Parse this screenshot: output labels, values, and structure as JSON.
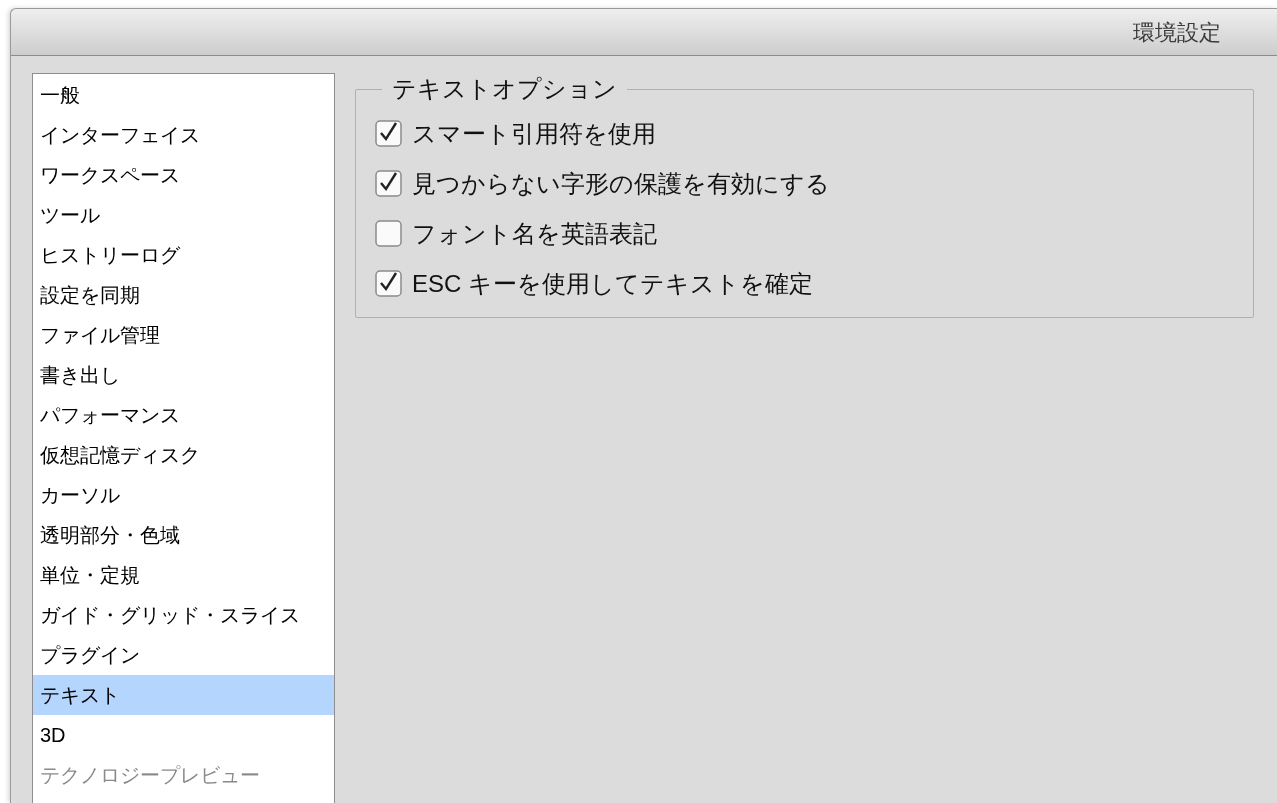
{
  "window": {
    "title": "環境設定"
  },
  "sidebar": {
    "items": [
      {
        "label": "一般",
        "selected": false,
        "disabled": false
      },
      {
        "label": "インターフェイス",
        "selected": false,
        "disabled": false
      },
      {
        "label": "ワークスペース",
        "selected": false,
        "disabled": false
      },
      {
        "label": "ツール",
        "selected": false,
        "disabled": false
      },
      {
        "label": "ヒストリーログ",
        "selected": false,
        "disabled": false
      },
      {
        "label": "設定を同期",
        "selected": false,
        "disabled": false
      },
      {
        "label": "ファイル管理",
        "selected": false,
        "disabled": false
      },
      {
        "label": "書き出し",
        "selected": false,
        "disabled": false
      },
      {
        "label": "パフォーマンス",
        "selected": false,
        "disabled": false
      },
      {
        "label": "仮想記憶ディスク",
        "selected": false,
        "disabled": false
      },
      {
        "label": "カーソル",
        "selected": false,
        "disabled": false
      },
      {
        "label": "透明部分・色域",
        "selected": false,
        "disabled": false
      },
      {
        "label": "単位・定規",
        "selected": false,
        "disabled": false
      },
      {
        "label": "ガイド・グリッド・スライス",
        "selected": false,
        "disabled": false
      },
      {
        "label": "プラグイン",
        "selected": false,
        "disabled": false
      },
      {
        "label": "テキスト",
        "selected": true,
        "disabled": false
      },
      {
        "label": "3D",
        "selected": false,
        "disabled": false
      },
      {
        "label": "テクノロジープレビュー",
        "selected": false,
        "disabled": true
      }
    ]
  },
  "group": {
    "title": "テキストオプション",
    "options": [
      {
        "label": "スマート引用符を使用",
        "checked": true
      },
      {
        "label": "見つからない字形の保護を有効にする",
        "checked": true
      },
      {
        "label": "フォント名を英語表記",
        "checked": false
      },
      {
        "label": "ESC キーを使用してテキストを確定",
        "checked": true
      }
    ]
  }
}
